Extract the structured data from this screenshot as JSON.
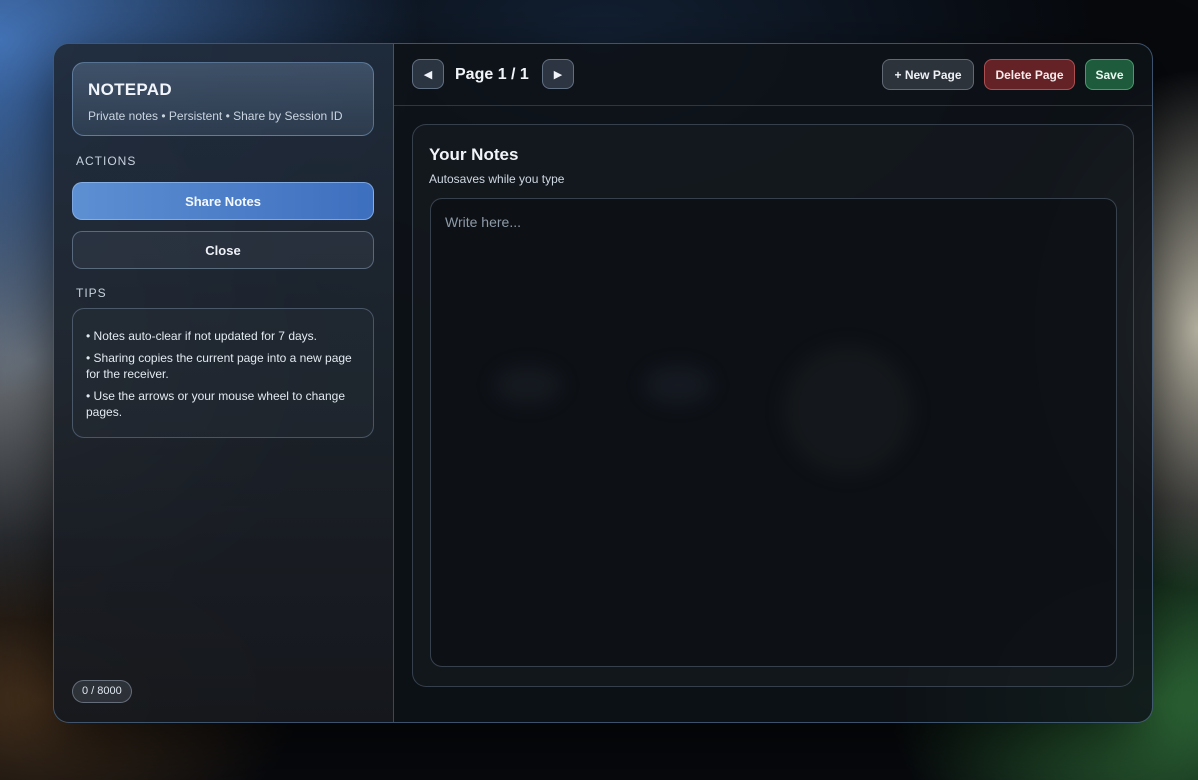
{
  "sidebar": {
    "brand": {
      "title": "NOTEPAD",
      "subtitle": "Private notes • Persistent • Share by Session ID"
    },
    "actions_label": "ACTIONS",
    "share_label": "Share Notes",
    "close_label": "Close",
    "tips_label": "TIPS",
    "tips": [
      "• Notes auto-clear if not updated for 7 days.",
      "• Sharing copies the current page into a new page for the receiver.",
      "• Use the arrows or your mouse wheel to change pages."
    ],
    "counter": "0 / 8000"
  },
  "toolbar": {
    "prev_icon": "◀",
    "next_icon": "▶",
    "page_indicator": "Page 1 / 1",
    "new_page_label": "+ New Page",
    "delete_page_label": "Delete Page",
    "save_label": "Save"
  },
  "notes": {
    "title": "Your Notes",
    "subtitle": "Autosaves while you type",
    "placeholder": "Write here...",
    "value": ""
  },
  "colors": {
    "accent": "#4a7fcb",
    "danger": "#822830",
    "success": "#236e46"
  }
}
